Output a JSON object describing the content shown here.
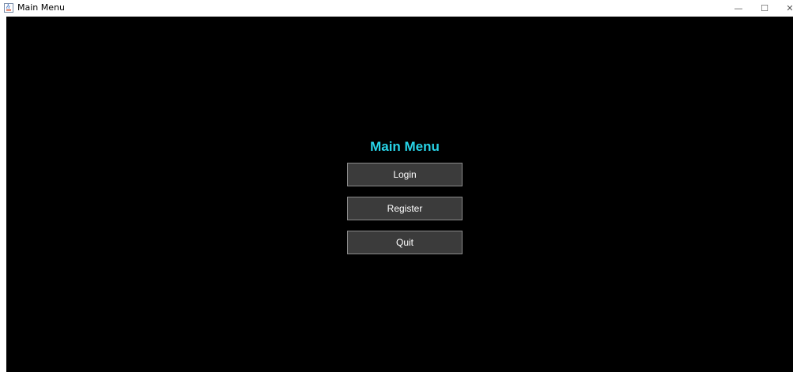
{
  "window": {
    "title": "Main Menu",
    "minimize_glyph": "—",
    "maximize_glyph": "☐",
    "close_glyph": "✕"
  },
  "menu": {
    "heading": "Main Menu",
    "login_label": "Login",
    "register_label": "Register",
    "quit_label": "Quit"
  },
  "colors": {
    "background": "#000000",
    "heading": "#28d4e8",
    "button_fill": "#3b3b3b",
    "button_border": "#8a8a8a",
    "button_text": "#ffffff"
  },
  "icons": {
    "app_icon": "java-coffee-cup-icon"
  }
}
